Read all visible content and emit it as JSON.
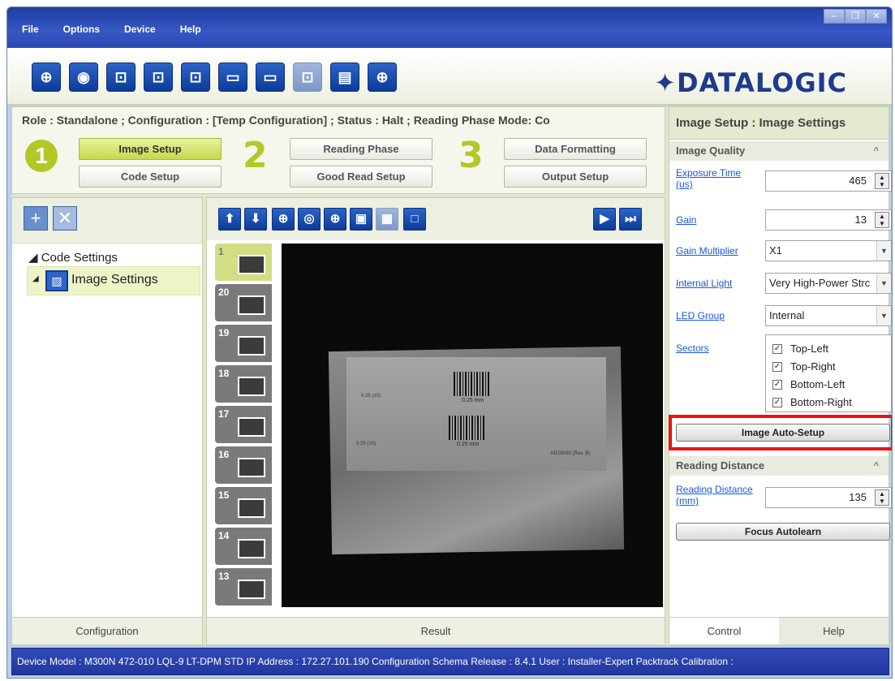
{
  "menu": [
    "File",
    "Options",
    "Device",
    "Help"
  ],
  "window_controls": [
    "minimize-icon",
    "restore-icon",
    "close-icon"
  ],
  "toolbar": {
    "icons": [
      "target-icon",
      "camera-settings-icon",
      "camera-add-icon",
      "camera-export-icon",
      "camera-save-icon",
      "folder-open-icon",
      "save-device-icon",
      "camera-disabled-icon",
      "monitor-icon",
      "crosshair-icon"
    ]
  },
  "brand": "DATALOGIC",
  "status_line": "Role : Standalone ; Configuration : [Temp Configuration] ; Status : Halt ; Reading Phase Mode: Co",
  "steps": {
    "one": "1",
    "two": "2",
    "three": "3",
    "image_setup": "Image Setup",
    "code_setup": "Code Setup",
    "reading_phase": "Reading Phase",
    "good_read_setup": "Good Read Setup",
    "data_formatting": "Data Formatting",
    "output_setup": "Output Setup"
  },
  "tree": {
    "root": "Code Settings",
    "child": "Image Settings"
  },
  "left_tab": "Configuration",
  "center_tab": "Result",
  "thumbs": [
    "1",
    "20",
    "19",
    "18",
    "17",
    "16",
    "15",
    "14",
    "13"
  ],
  "viewer": {
    "label1": "0.25 mm",
    "label2": "0.25 mm",
    "small1": "0.25 (10)",
    "small2": "0.25 (10)",
    "small3": "M100093 (Rev. B)"
  },
  "right": {
    "title": "Image Setup : Image Settings",
    "image_quality": "Image Quality",
    "exposure_label": "Exposure Time (us)",
    "exposure_value": "465",
    "gain_label": "Gain",
    "gain_value": "13",
    "gain_mult_label": "Gain Multiplier",
    "gain_mult_value": "X1",
    "internal_light_label": "Internal Light",
    "internal_light_value": "Very High-Power Strc",
    "led_group_label": "LED Group",
    "led_group_value": "Internal",
    "sectors_label": "Sectors",
    "sectors": [
      "Top-Left",
      "Top-Right",
      "Bottom-Left",
      "Bottom-Right"
    ],
    "auto_setup": "Image Auto-Setup",
    "reading_distance": "Reading Distance",
    "rd_label": "Reading Distance (mm)",
    "rd_value": "135",
    "focus": "Focus Autolearn",
    "tab_control": "Control",
    "tab_help": "Help"
  },
  "statusbar": "Device Model : M300N  472-010  LQL-9 LT-DPM STD   IP Address : 172.27.101.190   Configuration Schema Release : 8.4.1   User : Installer-Expert   Packtrack Calibration :",
  "colors": {
    "accent": "#b3c726",
    "highlight": "#ee1111",
    "title_blue": "#2a48b0"
  }
}
